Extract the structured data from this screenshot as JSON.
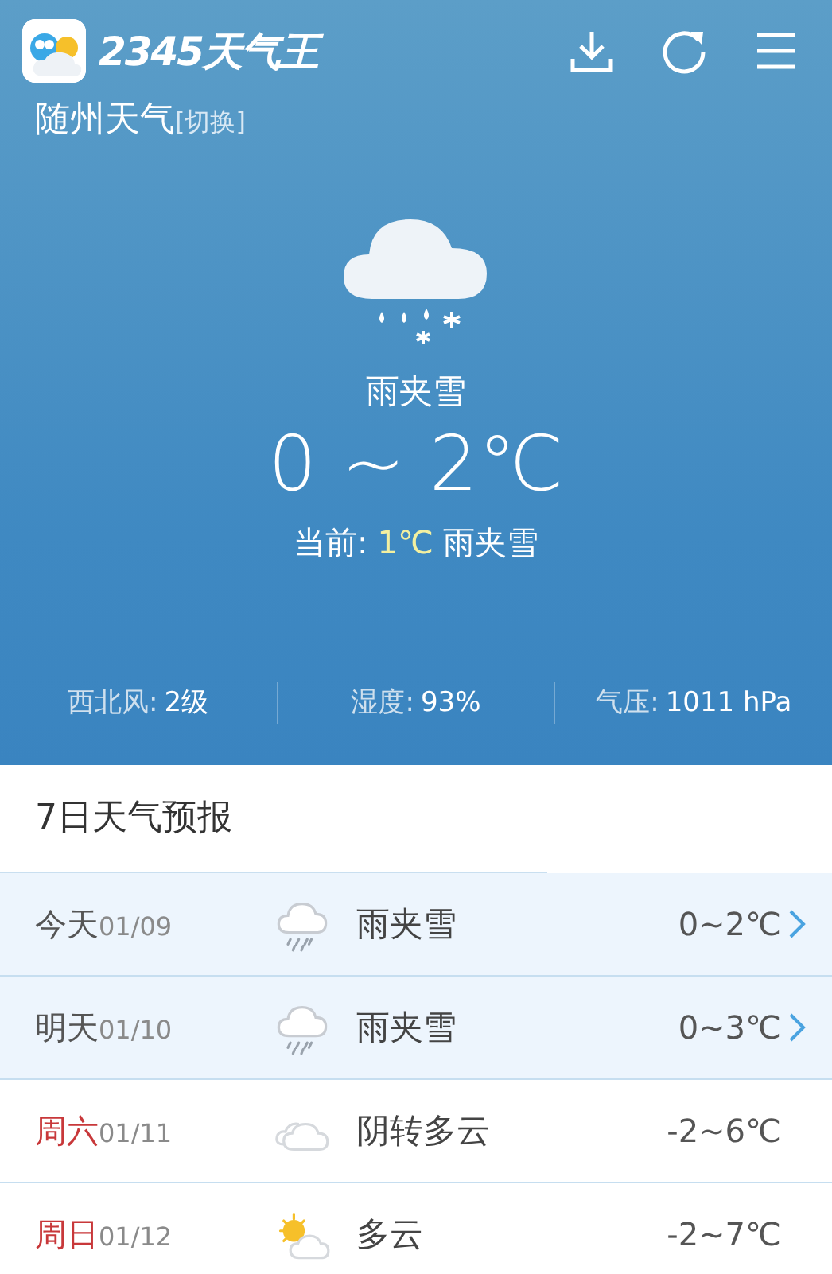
{
  "header": {
    "app_name": "2345天气王",
    "city": "随州天气",
    "switch_link": "[切换]"
  },
  "current": {
    "condition": "雨夹雪",
    "range": "0 ~ 2℃",
    "now_label": "当前:",
    "now_temp": "1℃",
    "now_condition": "雨夹雪"
  },
  "stats": [
    {
      "label": "西北风:",
      "value": "2级"
    },
    {
      "label": "湿度:",
      "value": "93%"
    },
    {
      "label": "气压:",
      "value": "1011 hPa"
    }
  ],
  "forecast": {
    "title": "7日天气预报",
    "days": [
      {
        "day": "今天",
        "date": "01/09",
        "kind": "sleet",
        "condition": "雨夹雪",
        "range": "0~2℃",
        "highlighted": true,
        "weekend": false
      },
      {
        "day": "明天",
        "date": "01/10",
        "kind": "sleet",
        "condition": "雨夹雪",
        "range": "0~3℃",
        "highlighted": true,
        "weekend": false
      },
      {
        "day": "周六",
        "date": "01/11",
        "kind": "cloudy",
        "condition": "阴转多云",
        "range": "-2~6℃",
        "highlighted": false,
        "weekend": true
      },
      {
        "day": "周日",
        "date": "01/12",
        "kind": "partly-sunny",
        "condition": "多云",
        "range": "-2~7℃",
        "highlighted": false,
        "weekend": true
      }
    ]
  }
}
